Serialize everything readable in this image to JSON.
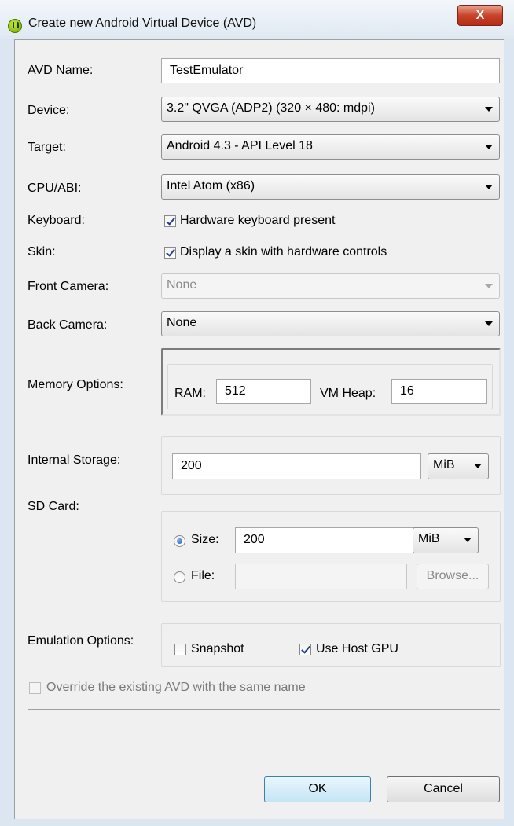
{
  "window": {
    "title": "Create new Android Virtual Device (AVD)",
    "close_label": "X"
  },
  "form": {
    "avd_name": {
      "label": "AVD Name:",
      "value": "TestEmulator"
    },
    "device": {
      "label": "Device:",
      "value": "3.2\" QVGA (ADP2) (320 × 480: mdpi)"
    },
    "target": {
      "label": "Target:",
      "value": "Android 4.3 - API Level 18"
    },
    "cpu_abi": {
      "label": "CPU/ABI:",
      "value": "Intel Atom (x86)"
    },
    "keyboard": {
      "label": "Keyboard:",
      "checkbox_label": "Hardware keyboard present",
      "checked": true
    },
    "skin": {
      "label": "Skin:",
      "checkbox_label": "Display a skin with hardware controls",
      "checked": true
    },
    "front_camera": {
      "label": "Front Camera:",
      "value": "None",
      "enabled": false
    },
    "back_camera": {
      "label": "Back Camera:",
      "value": "None"
    },
    "memory": {
      "label": "Memory Options:",
      "ram_label": "RAM:",
      "ram_value": "512",
      "vm_heap_label": "VM Heap:",
      "vm_heap_value": "16"
    },
    "internal_storage": {
      "label": "Internal Storage:",
      "value": "200",
      "unit": "MiB"
    },
    "sd_card": {
      "label": "SD Card:",
      "size_label": "Size:",
      "size_value": "200",
      "size_unit": "MiB",
      "size_selected": true,
      "file_label": "File:",
      "file_value": "",
      "browse_label": "Browse..."
    },
    "emulation": {
      "label": "Emulation Options:",
      "snapshot_label": "Snapshot",
      "snapshot_checked": false,
      "host_gpu_label": "Use Host GPU",
      "host_gpu_checked": true
    },
    "override": {
      "label": "Override the existing AVD with the same name",
      "enabled": false,
      "checked": false
    }
  },
  "buttons": {
    "ok": "OK",
    "cancel": "Cancel"
  },
  "colors": {
    "titlebar": "#dfe8f2",
    "close_button": "#c9432b",
    "default_button_border": "#3c7fb1",
    "window_background": "#f0f0f0"
  }
}
